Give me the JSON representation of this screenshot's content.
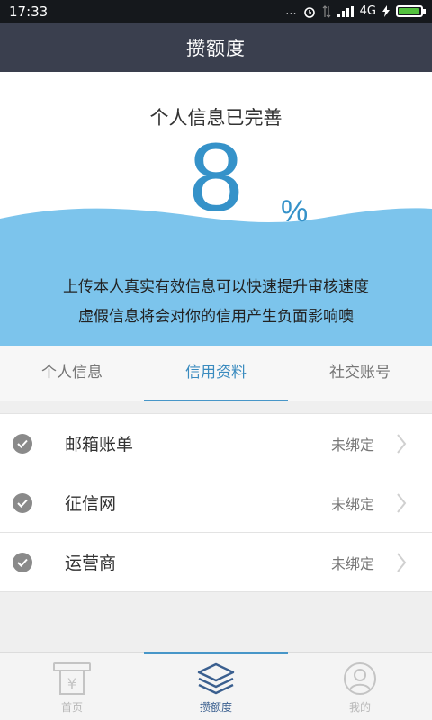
{
  "status_bar": {
    "time": "17:33",
    "dots": "...",
    "network": "4G",
    "battery_level": 0.9
  },
  "header": {
    "title": "攒额度"
  },
  "progress": {
    "heading": "个人信息已完善",
    "value": "8",
    "unit": "%",
    "message_line1": "上传本人真实有效信息可以快速提升审核速度",
    "message_line2": "虚假信息将会对你的信用产生负面影响噢"
  },
  "tabs": [
    {
      "label": "个人信息",
      "active": false
    },
    {
      "label": "信用资料",
      "active": true
    },
    {
      "label": "社交账号",
      "active": false
    }
  ],
  "items": [
    {
      "label": "邮箱账单",
      "status": "未绑定",
      "icon": "check-circle-icon"
    },
    {
      "label": "征信网",
      "status": "未绑定",
      "icon": "check-circle-icon"
    },
    {
      "label": "运营商",
      "status": "未绑定",
      "icon": "check-circle-icon"
    }
  ],
  "bottom_nav": [
    {
      "label": "首页",
      "icon": "atm-icon",
      "active": false
    },
    {
      "label": "攒额度",
      "icon": "layers-icon",
      "active": true
    },
    {
      "label": "我的",
      "icon": "profile-icon",
      "active": false
    }
  ],
  "colors": {
    "title_bar": "#3a3f4e",
    "accent": "#3592c9",
    "wave": "#7cc4ec",
    "tab_active": "#3a8bbf"
  }
}
